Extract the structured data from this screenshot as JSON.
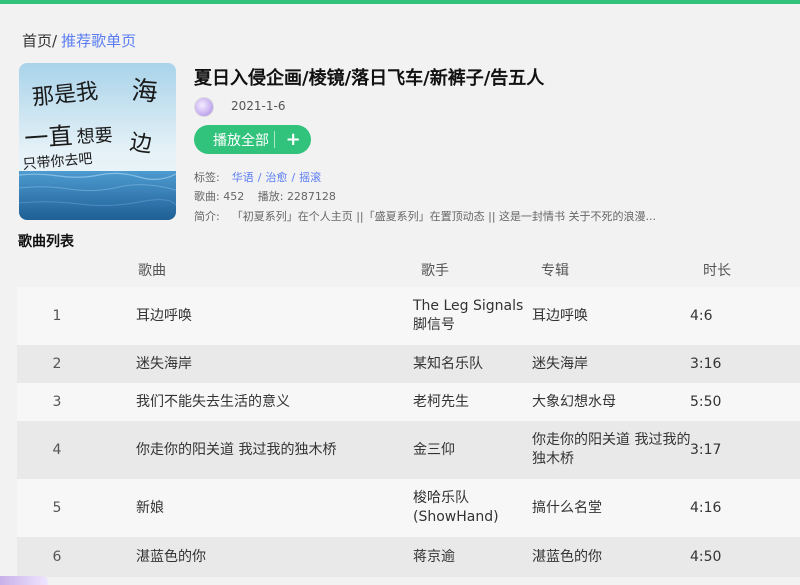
{
  "breadcrumb": {
    "home": "首页/",
    "current": "推荐歌单页"
  },
  "playlist": {
    "title": "夏日入侵企画/棱镜/落日飞车/新裤子/告五人",
    "date": "2021-1-6",
    "play_all_label": "播放全部",
    "add_icon_glyph": "+",
    "tags_label": "标签:",
    "tags": [
      "华语",
      "治愈",
      "摇滚"
    ],
    "tag_separator": "/",
    "song_count_label": "歌曲:",
    "song_count": "452",
    "play_count_label": "播放:",
    "play_count": "2287128",
    "intro_label": "简介:",
    "intro": "「初夏系列」在个人主页 ||「盛夏系列」在置顶动态 || 这是一封情书 关于不死的浪漫..."
  },
  "list": {
    "title": "歌曲列表",
    "columns": {
      "song": "歌曲",
      "artist": "歌手",
      "album": "专辑",
      "duration": "时长"
    },
    "rows": [
      {
        "index": "1",
        "song": "耳边呼唤",
        "artist": "The Leg Signals 脚信号",
        "album": "耳边呼唤",
        "duration": "4:6"
      },
      {
        "index": "2",
        "song": "迷失海岸",
        "artist": "某知名乐队",
        "album": "迷失海岸",
        "duration": "3:16"
      },
      {
        "index": "3",
        "song": "我们不能失去生活的意义",
        "artist": "老柯先生",
        "album": "大象幻想水母",
        "duration": "5:50"
      },
      {
        "index": "4",
        "song": "你走你的阳关道 我过我的独木桥",
        "artist": "金三仰",
        "album": "你走你的阳关道 我过我的独木桥",
        "duration": "3:17"
      },
      {
        "index": "5",
        "song": "新娘",
        "artist": "梭哈乐队(ShowHand)",
        "album": "搞什么名堂",
        "duration": "4:16"
      },
      {
        "index": "6",
        "song": "湛蓝色的你",
        "artist": "蒋京逾",
        "album": "湛蓝色的你",
        "duration": "4:50"
      }
    ]
  },
  "cover": {
    "handwriting": "那是我 海 一直想要 边 只带你去吧",
    "sky_color": "#cfe6f2",
    "sea_color": "#2f7fb8"
  },
  "colors": {
    "accent": "#31c27c",
    "link": "#5b7df2"
  }
}
